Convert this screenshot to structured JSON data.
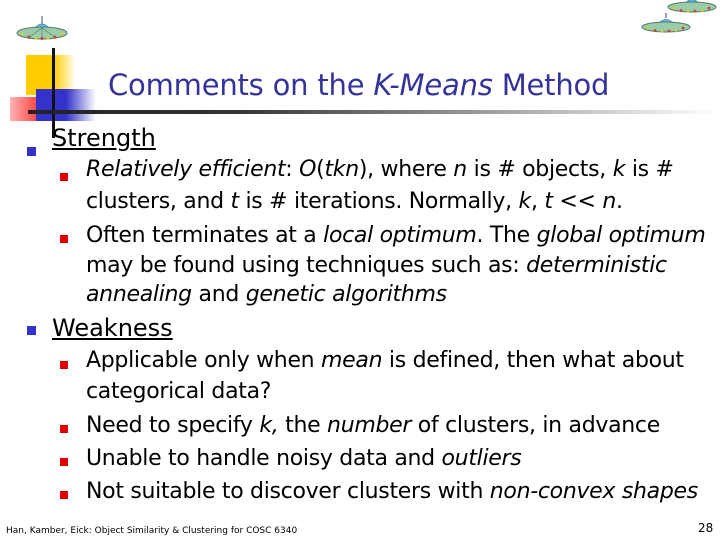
{
  "slide": {
    "title_parts": {
      "pre": "Comments on the ",
      "italic": "K-Means",
      "post": " Method"
    },
    "sections": [
      {
        "heading": "Strength",
        "items": [
          {
            "line1": [
              "",
              "Relatively efficient",
              ": ",
              "O",
              "(",
              "tkn",
              "), where ",
              "n",
              " is # objects, ",
              "k",
              " is #"
            ],
            "line2": [
              "clusters, and ",
              "t",
              "  is # iterations. Normally, ",
              "k",
              ", ",
              "t",
              " << ",
              "n",
              "."
            ]
          },
          {
            "line1": [
              "Often terminates at a ",
              "local optimum",
              ". The ",
              "global optimum"
            ],
            "line2": [
              "may be found using techniques such as: ",
              "deterministic"
            ],
            "line3": [
              "",
              "annealing",
              " and ",
              "genetic algorithms"
            ]
          }
        ]
      },
      {
        "heading": "Weakness",
        "items": [
          {
            "line1": [
              "Applicable only when ",
              "mean",
              " is defined, then what about"
            ],
            "line2": [
              "categorical data?"
            ]
          },
          {
            "line1": [
              "Need to specify ",
              "k,",
              " the ",
              "number",
              " of clusters, in advance"
            ]
          },
          {
            "line1": [
              "Unable to handle noisy data and ",
              "outliers"
            ]
          },
          {
            "line1": [
              "Not suitable to discover clusters with  ",
              "non-convex shapes"
            ]
          }
        ]
      }
    ],
    "footer": "Han, Kamber, Eick: Object Similarity & Clustering for COSC 6340",
    "page_number": "28"
  },
  "colors": {
    "title": "#333399",
    "level1_bullet": "#3333cc",
    "level2_bullet": "#e00000",
    "deco_yellow": "#ffcc00",
    "deco_blue": "#3333cc",
    "deco_red": "#ff3333"
  },
  "icons": {
    "ufo": "ufo-icon",
    "bullet": "square-bullet"
  }
}
